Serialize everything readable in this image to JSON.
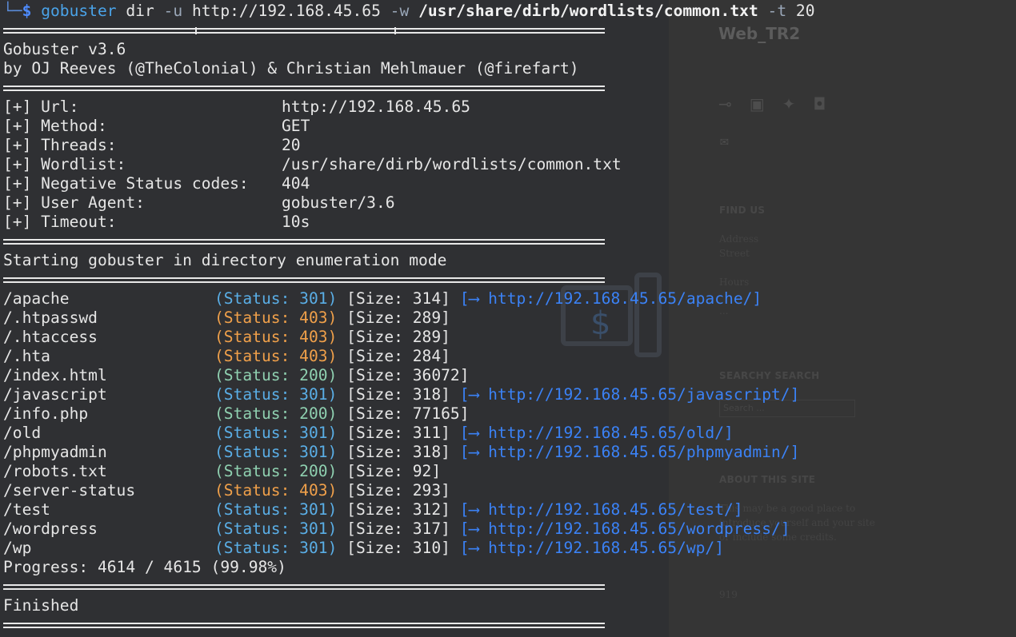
{
  "background_site": {
    "title": "Web_TR2",
    "social_icons": [
      "rss-icon",
      "facebook-icon",
      "twitter-icon",
      "instagram-icon"
    ],
    "mail_icon": "mail-icon",
    "find_us_heading": "FIND US",
    "address_label": "Address",
    "address_value": "Street",
    "hours_label": "Hours",
    "hours_value": "...",
    "search_heading": "SEARCHY SEARCH",
    "search_placeholder": "Search ...",
    "about_heading": "ABOUT THIS SITE",
    "about_text_1": "This may be a good place to",
    "about_text_2": "introduce yourself and your site",
    "about_text_3": "or include some credits.",
    "footer_text": "919"
  },
  "terminal": {
    "prompt_corner": "└─",
    "prompt_symbol": "$",
    "command": {
      "program": "gobuster",
      "subcommand": "dir",
      "flag_u": "-u",
      "url": "http://192.168.45.65",
      "flag_w": "-w",
      "wordlist": "/usr/share/dirb/wordlists/common.txt",
      "flag_t": "-t",
      "threads": "20"
    },
    "banner_version": "Gobuster v3.6",
    "banner_authors": "by OJ Reeves (@TheColonial) & Christian Mehlmauer (@firefart)",
    "config": [
      {
        "key": "[+] Url:",
        "value": "http://192.168.45.65"
      },
      {
        "key": "[+] Method:",
        "value": "GET"
      },
      {
        "key": "[+] Threads:",
        "value": "20"
      },
      {
        "key": "[+] Wordlist:",
        "value": "/usr/share/dirb/wordlists/common.txt"
      },
      {
        "key": "[+] Negative Status codes:",
        "value": "404"
      },
      {
        "key": "[+] User Agent:",
        "value": "gobuster/3.6"
      },
      {
        "key": "[+] Timeout:",
        "value": "10s"
      }
    ],
    "start_message": "Starting gobuster in directory enumeration mode",
    "results": [
      {
        "path": "/apache",
        "status": "301",
        "size": "314",
        "redirect": "http://192.168.45.65/apache/"
      },
      {
        "path": "/.htpasswd",
        "status": "403",
        "size": "289",
        "redirect": ""
      },
      {
        "path": "/.htaccess",
        "status": "403",
        "size": "289",
        "redirect": ""
      },
      {
        "path": "/.hta",
        "status": "403",
        "size": "284",
        "redirect": ""
      },
      {
        "path": "/index.html",
        "status": "200",
        "size": "36072",
        "redirect": ""
      },
      {
        "path": "/javascript",
        "status": "301",
        "size": "318",
        "redirect": "http://192.168.45.65/javascript/"
      },
      {
        "path": "/info.php",
        "status": "200",
        "size": "77165",
        "redirect": ""
      },
      {
        "path": "/old",
        "status": "301",
        "size": "311",
        "redirect": "http://192.168.45.65/old/"
      },
      {
        "path": "/phpmyadmin",
        "status": "301",
        "size": "318",
        "redirect": "http://192.168.45.65/phpmyadmin/"
      },
      {
        "path": "/robots.txt",
        "status": "200",
        "size": "92",
        "redirect": ""
      },
      {
        "path": "/server-status",
        "status": "403",
        "size": "293",
        "redirect": ""
      },
      {
        "path": "/test",
        "status": "301",
        "size": "312",
        "redirect": "http://192.168.45.65/test/"
      },
      {
        "path": "/wordpress",
        "status": "301",
        "size": "317",
        "redirect": "http://192.168.45.65/wordpress/"
      },
      {
        "path": "/wp",
        "status": "301",
        "size": "310",
        "redirect": "http://192.168.45.65/wp/"
      }
    ],
    "status_label": "Status:",
    "size_label": "Size:",
    "redirect_arrow": "⟶",
    "progress": "Progress: 4614 / 4615 (99.98%)",
    "finished": "Finished",
    "colors": {
      "status_301": "#5aaee6",
      "status_403": "#f0a04a",
      "status_200": "#8fd0b0",
      "link": "#3b82f6"
    }
  }
}
